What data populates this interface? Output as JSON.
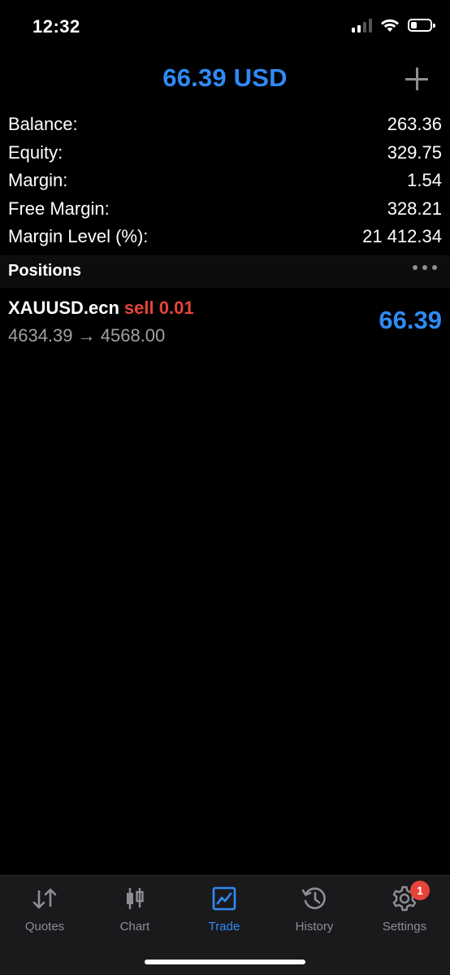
{
  "status_bar": {
    "time": "12:32"
  },
  "header": {
    "title": "66.39 USD"
  },
  "summary": [
    {
      "label": "Balance:",
      "value": "263.36"
    },
    {
      "label": "Equity:",
      "value": "329.75"
    },
    {
      "label": "Margin:",
      "value": "1.54"
    },
    {
      "label": "Free Margin:",
      "value": "328.21"
    },
    {
      "label": "Margin Level (%):",
      "value": "21 412.34"
    }
  ],
  "positions": {
    "title": "Positions",
    "items": [
      {
        "symbol": "XAUUSD.ecn",
        "side": "sell 0.01",
        "prices": "4634.39 → 4568.00",
        "profit": "66.39"
      }
    ]
  },
  "tabs": [
    {
      "label": "Quotes",
      "icon": "quotes-icon"
    },
    {
      "label": "Chart",
      "icon": "chart-icon"
    },
    {
      "label": "Trade",
      "icon": "trade-icon",
      "active": true
    },
    {
      "label": "History",
      "icon": "history-icon"
    },
    {
      "label": "Settings",
      "icon": "gear-icon",
      "badge": "1"
    }
  ],
  "colors": {
    "accent": "#2f8af5",
    "sell": "#e8433a",
    "badge": "#e8433a"
  }
}
